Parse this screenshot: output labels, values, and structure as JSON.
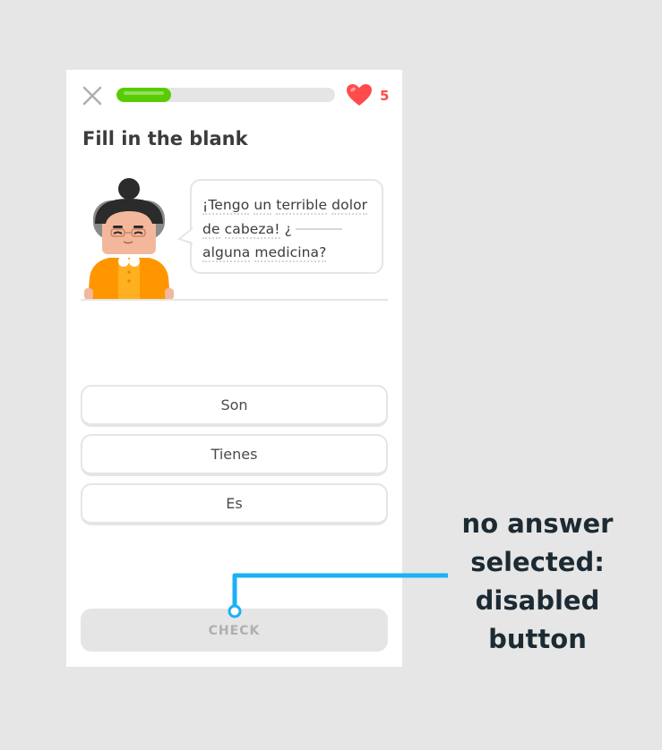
{
  "header": {
    "progress": 0.25,
    "hearts": "5"
  },
  "title": "Fill in the blank",
  "sentence": {
    "line1": [
      "¡Tengo",
      "un",
      "terrible",
      "dolor"
    ],
    "line2": [
      "de",
      "cabeza!",
      "¿"
    ],
    "line3": [
      "alguna",
      "medicina?"
    ]
  },
  "choices": [
    {
      "label": "Son"
    },
    {
      "label": "Tienes"
    },
    {
      "label": "Es"
    }
  ],
  "check_button": {
    "label": "CHECK",
    "disabled": true
  },
  "annotation": {
    "lines": [
      "no answer",
      "selected:",
      "disabled",
      "button"
    ],
    "color": "#1cb0f6"
  },
  "colors": {
    "progress": "#58cc02",
    "heart": "#ff4b4b",
    "character_shirt": "#ff9600"
  }
}
